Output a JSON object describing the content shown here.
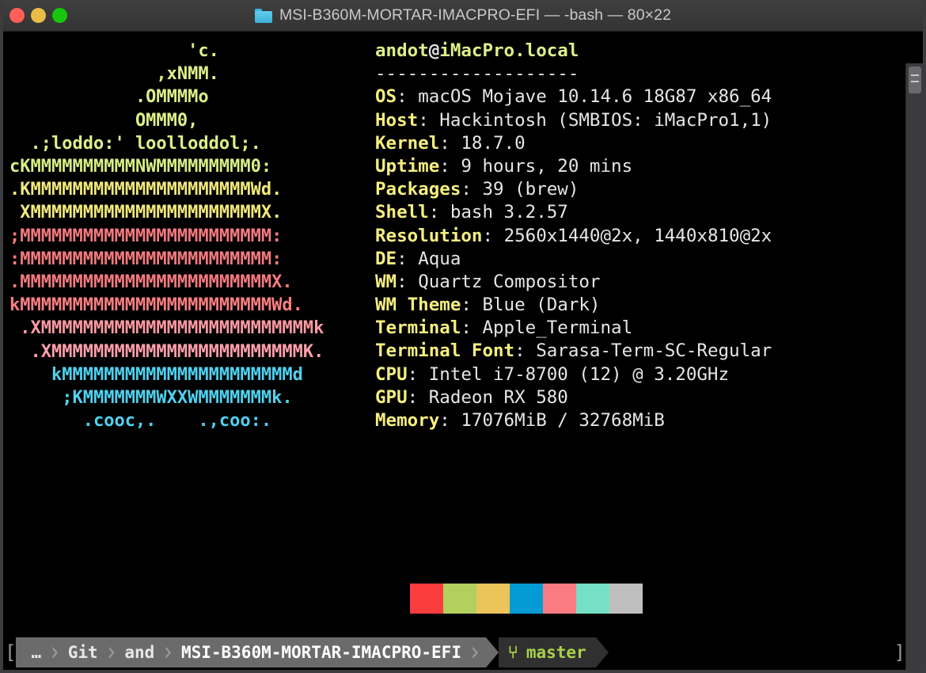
{
  "window": {
    "title": "MSI-B360M-MORTAR-IMACPRO-EFI — -bash — 80×22",
    "folder_icon": "folder-icon",
    "traffic": {
      "close_label": "close",
      "minimize_label": "minimize",
      "zoom_label": "zoom",
      "close_color": "#ff5f57",
      "minimize_color": "#e9bd48",
      "zoom_color": "#16c60c"
    }
  },
  "terminal": {
    "background": "#000000",
    "foreground": "#e6e6e6"
  },
  "neofetch": {
    "user_host": {
      "user": "andot",
      "at": "@",
      "host": "iMacPro.local",
      "color": "#ddf08a"
    },
    "separator": "-------------------",
    "label_color": "#f5ef7f",
    "value_color": "#e6e6e6",
    "entries": [
      {
        "key": "OS",
        "value": "macOS Mojave 10.14.6 18G87 x86_64"
      },
      {
        "key": "Host",
        "value": "Hackintosh (SMBIOS: iMacPro1,1)"
      },
      {
        "key": "Kernel",
        "value": "18.7.0"
      },
      {
        "key": "Uptime",
        "value": "9 hours, 20 mins"
      },
      {
        "key": "Packages",
        "value": "39 (brew)"
      },
      {
        "key": "Shell",
        "value": "bash 3.2.57"
      },
      {
        "key": "Resolution",
        "value": "2560x1440@2x, 1440x810@2x"
      },
      {
        "key": "DE",
        "value": "Aqua"
      },
      {
        "key": "WM",
        "value": "Quartz Compositor"
      },
      {
        "key": "WM Theme",
        "value": "Blue (Dark)"
      },
      {
        "key": "Terminal",
        "value": "Apple_Terminal"
      },
      {
        "key": "Terminal Font",
        "value": "Sarasa-Term-SC-Regular"
      },
      {
        "key": "CPU",
        "value": "Intel i7-8700 (12) @ 3.20GHz"
      },
      {
        "key": "GPU",
        "value": "Radeon RX 580"
      },
      {
        "key": "Memory",
        "value": "17076MiB / 32768MiB"
      }
    ],
    "ascii_art": [
      {
        "text": "                 'c.",
        "color": "#ddf08a"
      },
      {
        "text": "              ,xNMM.",
        "color": "#ddf08a"
      },
      {
        "text": "            .OMMMMo",
        "color": "#ddf08a"
      },
      {
        "text": "            OMMM0,",
        "color": "#ddf08a"
      },
      {
        "text": "  .;loddo:' loolloddol;.",
        "color": "#ddf08a"
      },
      {
        "text": "cKMMMMMMMMMMNWMMMMMMMMM0:",
        "color": "#d9ee86"
      },
      {
        "text": ".KMMMMMMMMMMMMMMMMMMMMMWd.",
        "color": "#f1e97c"
      },
      {
        "text": " XMMMMMMMMMMMMMMMMMMMMMMX.",
        "color": "#f1e97c"
      },
      {
        "text": ";MMMMMMMMMMMMMMMMMMMMMMMM:",
        "color": "#f47a7f"
      },
      {
        "text": ":MMMMMMMMMMMMMMMMMMMMMMMM:",
        "color": "#f47a7f"
      },
      {
        "text": ".MMMMMMMMMMMMMMMMMMMMMMMMX.",
        "color": "#f47a7f"
      },
      {
        "text": "kMMMMMMMMMMMMMMMMMMMMMMMMWd.",
        "color": "#fa7f82"
      },
      {
        "text": " .XMMMMMMMMMMMMMMMMMMMMMMMMMMk",
        "color": "#ff9aa2"
      },
      {
        "text": "  .XMMMMMMMMMMMMMMMMMMMMMMMMK.",
        "color": "#ffa0ab"
      },
      {
        "text": "    kMMMMMMMMMMMMMMMMMMMMMMd",
        "color": "#4fd2f0"
      },
      {
        "text": "     ;KMMMMMMMWXXWMMMMMMMk.",
        "color": "#4fd2f0"
      },
      {
        "text": "       .cooc,.    .,coo:.",
        "color": "#4fd2f0"
      }
    ],
    "palette_colors": [
      "#fa3c3c",
      "#b3cf5e",
      "#ebc45a",
      "#049bd4",
      "#fb7b83",
      "#75e0c6",
      "#bfbfbf"
    ]
  },
  "prompt": {
    "bracket_left": "[",
    "bracket_right": "]",
    "chevron": "›",
    "path_segments": [
      "…",
      "Git",
      "and",
      "MSI-B360M-MORTAR-IMACPRO-EFI"
    ],
    "git_glyph": "⑂",
    "git_branch": "master",
    "path_bg": "#6b6b6b",
    "git_bg": "#303030",
    "git_fg": "#a6d14a"
  },
  "scrollbar": {
    "name": "vertical-scrollbar"
  }
}
